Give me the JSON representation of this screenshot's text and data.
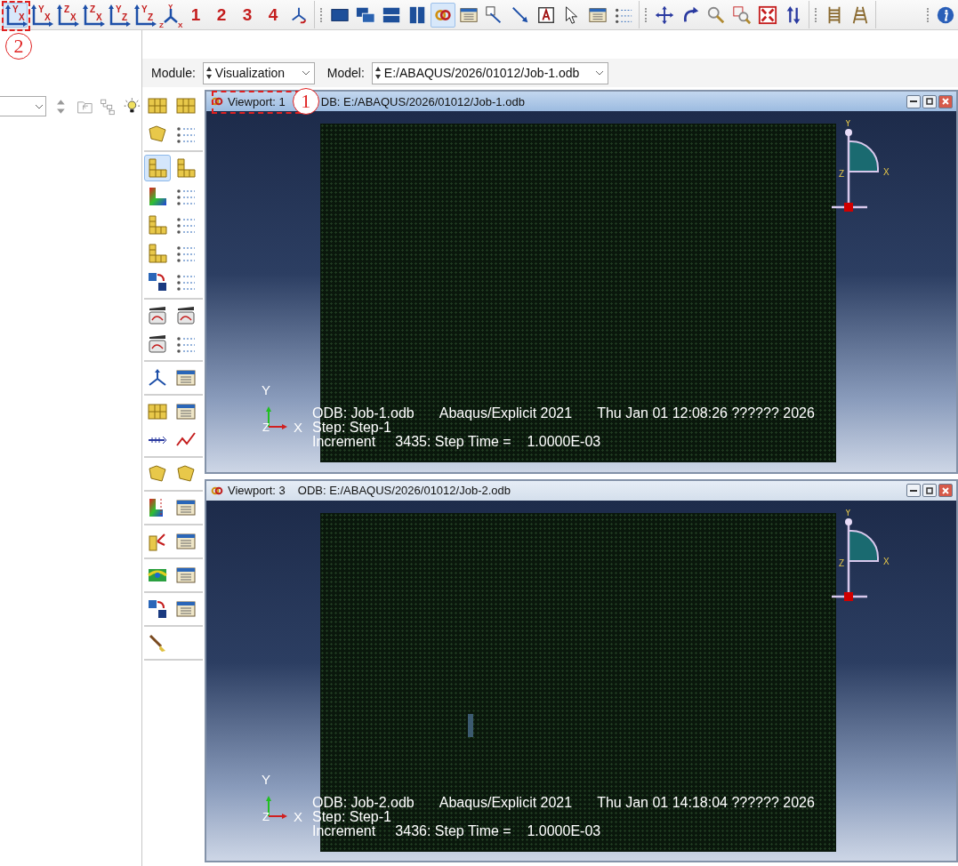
{
  "toolbar": {
    "view_buttons": [
      {
        "labels": [
          "Y",
          "X"
        ],
        "selected": true
      },
      {
        "labels": [
          "Y",
          "X"
        ],
        "selected": false
      },
      {
        "labels": [
          "Z",
          "X"
        ],
        "selected": false
      },
      {
        "labels": [
          "Z",
          "X"
        ],
        "selected": false
      },
      {
        "labels": [
          "Y",
          "Z"
        ],
        "selected": false
      },
      {
        "labels": [
          "Y",
          "Z"
        ],
        "selected": false
      },
      {
        "labels": [
          "Y",
          "Z",
          "X"
        ],
        "selected": false
      }
    ],
    "number_buttons": [
      {
        "label": "1"
      },
      {
        "label": "2"
      },
      {
        "label": "3"
      },
      {
        "label": "4"
      }
    ],
    "link_viewports_selected": true
  },
  "annotations": [
    {
      "label": "2"
    }
  ],
  "module_bar": {
    "module_label": "Module:",
    "module": "Visualization",
    "model_label": "Model:",
    "model": "E:/ABAQUS/2026/01012/Job-1.odb"
  },
  "toolbox": [
    {
      "tools": [
        {
          "selected": false
        },
        {
          "selected": false
        },
        {
          "selected": false
        },
        {
          "selected": false
        }
      ]
    },
    {
      "tools": [
        {
          "selected": true
        },
        {
          "selected": false
        },
        {
          "selected": false
        },
        {
          "selected": false
        },
        {
          "selected": false
        },
        {
          "selected": false
        },
        {
          "selected": false
        },
        {
          "selected": false
        },
        {
          "selected": false
        },
        {
          "selected": false
        }
      ]
    },
    {
      "tools": [
        {
          "selected": false
        },
        {
          "selected": false
        },
        {
          "selected": false
        },
        {
          "selected": false
        }
      ]
    },
    {
      "tools": [
        {
          "selected": false
        },
        {
          "selected": false
        }
      ]
    },
    {
      "tools": [
        {
          "selected": false
        },
        {
          "selected": false
        },
        {
          "selected": false
        },
        {
          "selected": false
        }
      ]
    },
    {
      "tools": [
        {
          "selected": false
        },
        {
          "selected": false
        }
      ]
    },
    {
      "tools": [
        {
          "selected": false
        },
        {
          "selected": false
        }
      ]
    },
    {
      "tools": [
        {
          "selected": false
        },
        {
          "selected": false
        }
      ]
    },
    {
      "tools": [
        {
          "selected": false
        },
        {
          "selected": false
        }
      ]
    },
    {
      "tools": [
        {
          "selected": false
        },
        {
          "selected": false
        }
      ]
    },
    {
      "tools": [
        {
          "selected": false
        }
      ]
    }
  ],
  "viewports": [
    {
      "title": "Viewport: 1",
      "annotation": "1",
      "odb_path": "DB: E:/ABAQUS/2026/01012/Job-1.odb",
      "active": true,
      "show_sliver": false,
      "triad_labels": [
        "Y",
        "Z",
        "X"
      ],
      "compass_labels": [
        "Y",
        "Z",
        "X"
      ],
      "info": {
        "odb": "ODB: Job-1.odb",
        "solver": "Abaqus/Explicit 2021",
        "date": "Thu Jan 01 12:08:26 ?????? 2026",
        "step": "Step: Step-1",
        "increment": "Increment     3435: Step Time =    1.0000E-03"
      }
    },
    {
      "title": "Viewport: 3",
      "odb_path": "ODB: E:/ABAQUS/2026/01012/Job-2.odb",
      "active": false,
      "show_sliver": true,
      "triad_labels": [
        "Y",
        "Z",
        "X"
      ],
      "compass_labels": [
        "Y",
        "Z",
        "X"
      ],
      "info": {
        "odb": "ODB: Job-2.odb",
        "solver": "Abaqus/Explicit 2021",
        "date": "Thu Jan 01 14:18:04 ?????? 2026",
        "step": "Step: Step-1",
        "increment": "Increment     3436: Step Time =    1.0000E-03"
      }
    }
  ]
}
